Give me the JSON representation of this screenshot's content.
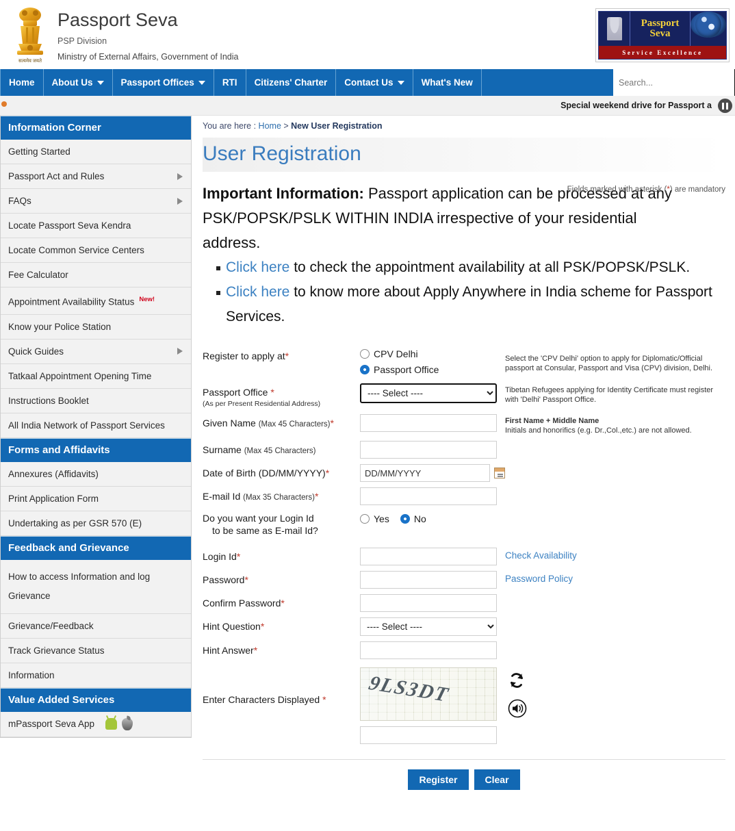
{
  "header": {
    "brand_title": "Passport Seva",
    "brand_sub1": "PSP Division",
    "brand_sub2": "Ministry of External Affairs, Government of India",
    "logo_line1": "Passport",
    "logo_line2": "Seva",
    "logo_tagline": "Service Excellence"
  },
  "nav": {
    "items": [
      {
        "label": "Home",
        "caret": false
      },
      {
        "label": "About Us",
        "caret": true
      },
      {
        "label": "Passport Offices",
        "caret": true
      },
      {
        "label": "RTI",
        "caret": false
      },
      {
        "label": "Citizens' Charter",
        "caret": false
      },
      {
        "label": "Contact Us",
        "caret": true
      },
      {
        "label": "What's New",
        "caret": false
      }
    ],
    "search_placeholder": "Search...",
    "search_value": ""
  },
  "marquee": {
    "text": "Special weekend drive for Passport a"
  },
  "sidebar": {
    "sections": [
      {
        "title": "Information Corner",
        "items": [
          {
            "label": "Getting Started",
            "arrow": false,
            "badge": ""
          },
          {
            "label": "Passport Act and Rules",
            "arrow": true,
            "badge": ""
          },
          {
            "label": "FAQs",
            "arrow": true,
            "badge": ""
          },
          {
            "label": "Locate Passport Seva Kendra",
            "arrow": false,
            "badge": ""
          },
          {
            "label": "Locate Common Service Centers",
            "arrow": false,
            "badge": ""
          },
          {
            "label": "Fee Calculator",
            "arrow": false,
            "badge": ""
          },
          {
            "label": "Appointment Availability Status",
            "arrow": false,
            "badge": "New!"
          },
          {
            "label": "Know your Police Station",
            "arrow": false,
            "badge": ""
          },
          {
            "label": "Quick Guides",
            "arrow": true,
            "badge": ""
          },
          {
            "label": "Tatkaal Appointment Opening Time",
            "arrow": false,
            "badge": ""
          },
          {
            "label": "Instructions Booklet",
            "arrow": false,
            "badge": ""
          },
          {
            "label": "All India Network of Passport Services",
            "arrow": false,
            "badge": ""
          }
        ]
      },
      {
        "title": "Forms and Affidavits",
        "items": [
          {
            "label": "Annexures (Affidavits)",
            "arrow": false,
            "badge": ""
          },
          {
            "label": "Print Application Form",
            "arrow": false,
            "badge": ""
          },
          {
            "label": "Undertaking as per GSR 570 (E)",
            "arrow": false,
            "badge": ""
          }
        ]
      },
      {
        "title": "Feedback and Grievance",
        "items": [
          {
            "label": "How to access Information and log Grievance",
            "arrow": false,
            "badge": "",
            "two_line": true
          },
          {
            "label": "Grievance/Feedback",
            "arrow": false,
            "badge": ""
          },
          {
            "label": "Track Grievance Status",
            "arrow": false,
            "badge": ""
          },
          {
            "label": "Information",
            "arrow": false,
            "badge": ""
          }
        ]
      },
      {
        "title": "Value Added Services",
        "items": [
          {
            "label": "mPassport Seva App",
            "arrow": false,
            "badge": "",
            "store_icons": true
          }
        ]
      }
    ]
  },
  "breadcrumb": {
    "prefix": "You are here : ",
    "home": "Home",
    "sep": " > ",
    "current": "New User Registration"
  },
  "page": {
    "title": "User Registration",
    "mandatory_note_pre": "Fields marked with asterisk (",
    "mandatory_note_ast": "*",
    "mandatory_note_post": ") are mandatory",
    "important_label": "Important Information:",
    "important_text": " Passport application can be processed at any PSK/POPSK/PSLK WITHIN INDIA irrespective of your residential address.",
    "bullets": [
      {
        "link": "Click here",
        "text": " to check the appointment availability at all PSK/POPSK/PSLK."
      },
      {
        "link": "Click here",
        "text": " to know more about Apply Anywhere in India scheme for Passport Services."
      }
    ]
  },
  "form": {
    "register_at": {
      "label": "Register to apply at",
      "req": "*",
      "options": [
        {
          "label": "CPV Delhi",
          "selected": false
        },
        {
          "label": "Passport Office",
          "selected": true
        }
      ],
      "hint": "Select the 'CPV Delhi' option to apply for Diplomatic/Official passport at Consular, Passport and Visa (CPV) division, Delhi."
    },
    "passport_office": {
      "label": "Passport Office ",
      "req": "*",
      "sub": "(As per Present Residential Address)",
      "value": "---- Select ----",
      "hint": "Tibetan Refugees applying for Identity Certificate must register with 'Delhi' Passport Office."
    },
    "given_name": {
      "label": "Given Name ",
      "label_small": "(Max 45 Characters)",
      "req": "*",
      "value": "",
      "hint_bold": "First Name + Middle Name",
      "hint": "Initials and honorifics (e.g. Dr.,Col.,etc.) are not allowed."
    },
    "surname": {
      "label": "Surname ",
      "label_small": "(Max 45 Characters)",
      "req": "",
      "value": ""
    },
    "dob": {
      "label": "Date of Birth (DD/MM/YYYY)",
      "req": "*",
      "placeholder": "DD/MM/YYYY",
      "value": ""
    },
    "email": {
      "label": "E-mail Id ",
      "label_small": "(Max 35 Characters)",
      "req": "*",
      "value": ""
    },
    "login_same": {
      "label_line1": "Do you want your Login Id",
      "label_line2": "to be same as E-mail Id?",
      "options": [
        {
          "label": "Yes",
          "selected": false
        },
        {
          "label": "No",
          "selected": true
        }
      ]
    },
    "login_id": {
      "label": "Login Id",
      "req": "*",
      "value": "",
      "side_link": "Check Availability"
    },
    "password": {
      "label": "Password",
      "req": "*",
      "value": "",
      "side_link": "Password Policy"
    },
    "confirm_password": {
      "label": "Confirm Password",
      "req": "*",
      "value": ""
    },
    "hint_question": {
      "label": "Hint Question",
      "req": "*",
      "value": "---- Select ----"
    },
    "hint_answer": {
      "label": "Hint Answer",
      "req": "*",
      "value": ""
    },
    "captcha": {
      "label": "Enter Characters Displayed ",
      "req": "*",
      "image_text": "9LS3DT",
      "value": ""
    },
    "buttons": {
      "register": "Register",
      "clear": "Clear"
    }
  }
}
